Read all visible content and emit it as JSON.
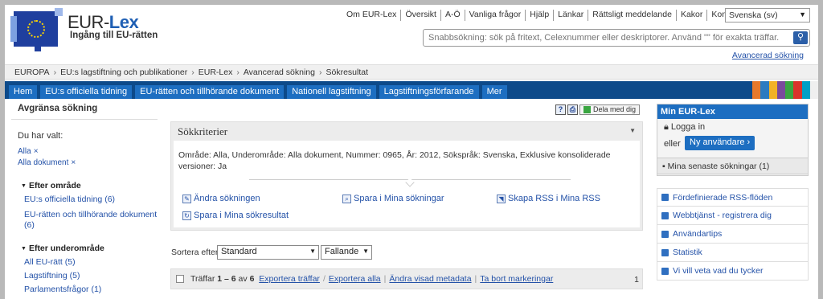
{
  "header": {
    "brand_prefix": "EUR-",
    "brand_suffix": "Lex",
    "tagline": "Ingång till EU-rätten",
    "top_links": [
      "Om EUR-Lex",
      "Översikt",
      "A-Ö",
      "Vanliga frågor",
      "Hjälp",
      "Länkar",
      "Rättsligt meddelande",
      "Kakor",
      "Kontakt"
    ],
    "language": "Svenska (sv)",
    "search_placeholder": "Snabbsökning: sök på fritext, Celexnummer eller deskriptorer. Använd \"\" för exakta träffar.",
    "advanced_search": "Avancerad sökning"
  },
  "breadcrumb": [
    "EUROPA",
    "EU:s lagstiftning och publikationer",
    "EUR-Lex",
    "Avancerad sökning",
    "Sökresultat"
  ],
  "nav_tabs": [
    "Hem",
    "EU:s officiella tidning",
    "EU-rätten och tillhörande dokument",
    "Nationell lagstiftning",
    "Lagstiftningsförfarande",
    "Mer"
  ],
  "nav_stripe_colors": [
    "#e8792b",
    "#2b7bc1",
    "#f2b227",
    "#7a4a9c",
    "#3aa641",
    "#d9342b",
    "#00a0c6",
    "#efefef"
  ],
  "left": {
    "title": "Avgränsa sökning",
    "selected_label": "Du har valt:",
    "selected": [
      "Alla",
      "Alla dokument"
    ],
    "remove_glyph": "×",
    "area_title": "Efter område",
    "area_items": [
      "EU:s officiella tidning (6)",
      "EU-rätten och tillhörande dokument (6)"
    ],
    "subarea_title": "Efter underområde",
    "subarea_items": [
      "All EU-rätt (5)",
      "Lagstiftning (5)",
      "Parlamentsfrågor (1)"
    ]
  },
  "main": {
    "tools": {
      "help": "?",
      "print": "⎙",
      "share": "Dela med dig"
    },
    "criteria_title": "Sökkriterier",
    "criteria_text": "Område: Alla, Underområde: Alla dokument, Nummer: 0965, År: 2012, Sökspråk: Svenska, Exklusive konsoliderade versioner: Ja",
    "actions": {
      "edit": "Ändra sökningen",
      "save_search": "Spara i Mina sökningar",
      "rss": "Skapa RSS i Mina RSS",
      "save_results": "Spara i Mina sökresultat"
    },
    "sort_label": "Sortera efter",
    "sort_value": "Standard",
    "order_value": "Fallande",
    "hits_prefix": "Träffar",
    "hits_range": "1 – 6",
    "hits_of": "av",
    "hits_total": "6",
    "export_hits": "Exportera träffar",
    "export_all": "Exportera alla",
    "change_metadata": "Ändra visad metadata",
    "remove_marks": "Ta bort markeringar",
    "page_number": "1"
  },
  "right": {
    "my_title": "Min EUR-Lex",
    "login": "Logga in",
    "or": "eller",
    "new_user": "Ny användare ›",
    "recent": "Mina senaste sökningar (1)",
    "links": [
      "Fördefinierade RSS-flöden",
      "Webbtjänst - registrera dig",
      "Användartips",
      "Statistik",
      "Vi vill veta vad du tycker"
    ]
  }
}
